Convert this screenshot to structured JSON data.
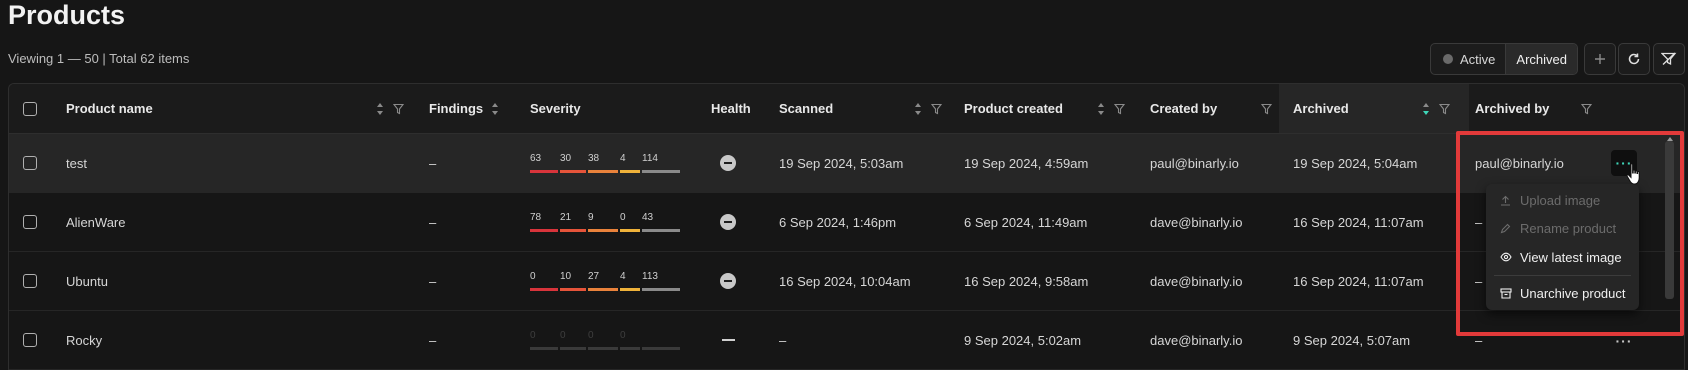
{
  "page": {
    "title": "Products",
    "viewing": "Viewing 1 — 50 | Total 62 items"
  },
  "toolbar": {
    "toggle_active": "Active",
    "toggle_archived": "Archived",
    "add_icon": "plus-icon",
    "refresh_icon": "refresh-icon",
    "clear_filter_icon": "filter-clear-icon"
  },
  "table": {
    "columns": {
      "product_name": "Product name",
      "findings": "Findings",
      "severity": "Severity",
      "health": "Health",
      "scanned": "Scanned",
      "product_created": "Product created",
      "created_by": "Created by",
      "archived": "Archived",
      "archived_by": "Archived by"
    },
    "rows": [
      {
        "name": "test",
        "findings": "–",
        "severity": [
          "63",
          "30",
          "38",
          "4",
          "114"
        ],
        "health": "neutral",
        "scanned": "19 Sep 2024, 5:03am",
        "created": "19 Sep 2024, 4:59am",
        "created_by": "paul@binarly.io",
        "archived": "19 Sep 2024, 5:04am",
        "archived_by": "paul@binarly.io"
      },
      {
        "name": "AlienWare",
        "findings": "–",
        "severity": [
          "78",
          "21",
          "9",
          "0",
          "43"
        ],
        "health": "neutral",
        "scanned": "6 Sep 2024, 1:46pm",
        "created": "6 Sep 2024, 11:49am",
        "created_by": "dave@binarly.io",
        "archived": "16 Sep 2024, 11:07am",
        "archived_by": "–"
      },
      {
        "name": "Ubuntu",
        "findings": "–",
        "severity": [
          "0",
          "10",
          "27",
          "4",
          "113"
        ],
        "health": "neutral",
        "scanned": "16 Sep 2024, 10:04am",
        "created": "16 Sep 2024, 9:58am",
        "created_by": "dave@binarly.io",
        "archived": "16 Sep 2024, 11:07am",
        "archived_by": "–"
      },
      {
        "name": "Rocky",
        "findings": "–",
        "severity": [
          "0",
          "0",
          "0",
          "0",
          ""
        ],
        "health": "none",
        "scanned": "–",
        "created": "9 Sep 2024, 5:02am",
        "created_by": "dave@binarly.io",
        "archived": "9 Sep 2024, 5:07am",
        "archived_by": "–"
      }
    ]
  },
  "severity_colors": {
    "critical": "#d8343b",
    "high": "#e6543a",
    "medium": "#e9823b",
    "low": "#efb23a",
    "info": "#8a8a8a",
    "empty": "#3a3a3a"
  },
  "row_menu": {
    "items": [
      {
        "label": "Upload image",
        "icon": "upload-icon",
        "enabled": false
      },
      {
        "label": "Rename product",
        "icon": "pencil-icon",
        "enabled": false
      },
      {
        "label": "View latest image",
        "icon": "eye-icon",
        "enabled": true
      },
      {
        "label": "Unarchive product",
        "icon": "unarchive-icon",
        "enabled": true
      }
    ]
  },
  "accent_color": "#3ed6b8",
  "highlight_color": "#e23a3a"
}
